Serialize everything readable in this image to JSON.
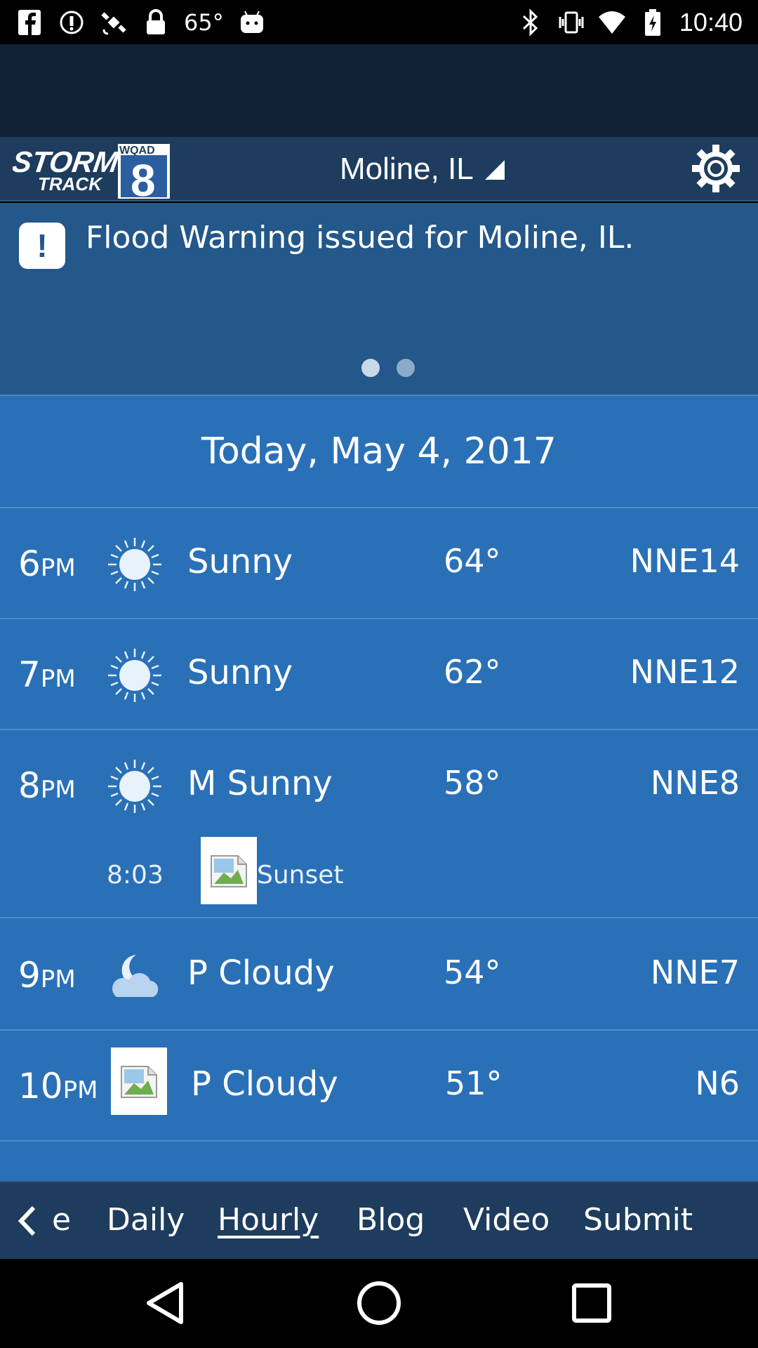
{
  "status_bar": {
    "temperature": "65°",
    "time": "10:40",
    "icons_left": [
      "facebook-icon",
      "info-icon",
      "satellite-icon",
      "lock-icon",
      "android-icon"
    ],
    "icons_right": [
      "bluetooth-icon",
      "vibrate-icon",
      "wifi-icon",
      "battery-icon"
    ]
  },
  "header": {
    "logo_line1": "STORM",
    "logo_line2": "TRACK",
    "logo_station": "WQAD",
    "logo_number": "8",
    "location": "Moline, IL",
    "settings_icon": "gear-icon"
  },
  "alert": {
    "icon": "exclamation-icon",
    "symbol": "!",
    "text": "Flood Warning issued for Moline, IL.",
    "pages": 2,
    "active_page": 1
  },
  "forecast": {
    "date_label": "Today, May 4, 2017",
    "rows": [
      {
        "hour": "6",
        "ampm": "PM",
        "icon": "sun-icon",
        "condition": "Sunny",
        "temp": "64°",
        "wind": "NNE14"
      },
      {
        "hour": "7",
        "ampm": "PM",
        "icon": "sun-icon",
        "condition": "Sunny",
        "temp": "62°",
        "wind": "NNE12"
      },
      {
        "hour": "8",
        "ampm": "PM",
        "icon": "sun-icon",
        "condition": "M Sunny",
        "temp": "58°",
        "wind": "NNE8"
      },
      {
        "hour": "9",
        "ampm": "PM",
        "icon": "moon-cloud-icon",
        "condition": "P Cloudy",
        "temp": "54°",
        "wind": "NNE7"
      },
      {
        "hour": "10",
        "ampm": "PM",
        "icon": "broken-image-icon",
        "condition": "P Cloudy",
        "temp": "51°",
        "wind": "N6"
      }
    ],
    "sunset": {
      "time": "8:03",
      "label": "Sunset"
    }
  },
  "bottom_nav": {
    "items": [
      "e",
      "Daily",
      "Hourly",
      "Blog",
      "Video",
      "Submit"
    ],
    "active": "Hourly"
  },
  "colors": {
    "header_bg": "#1e3c5d",
    "alert_bg": "#24578a",
    "list_bg": "#2a70b7",
    "divider": "#4f8bc6"
  }
}
